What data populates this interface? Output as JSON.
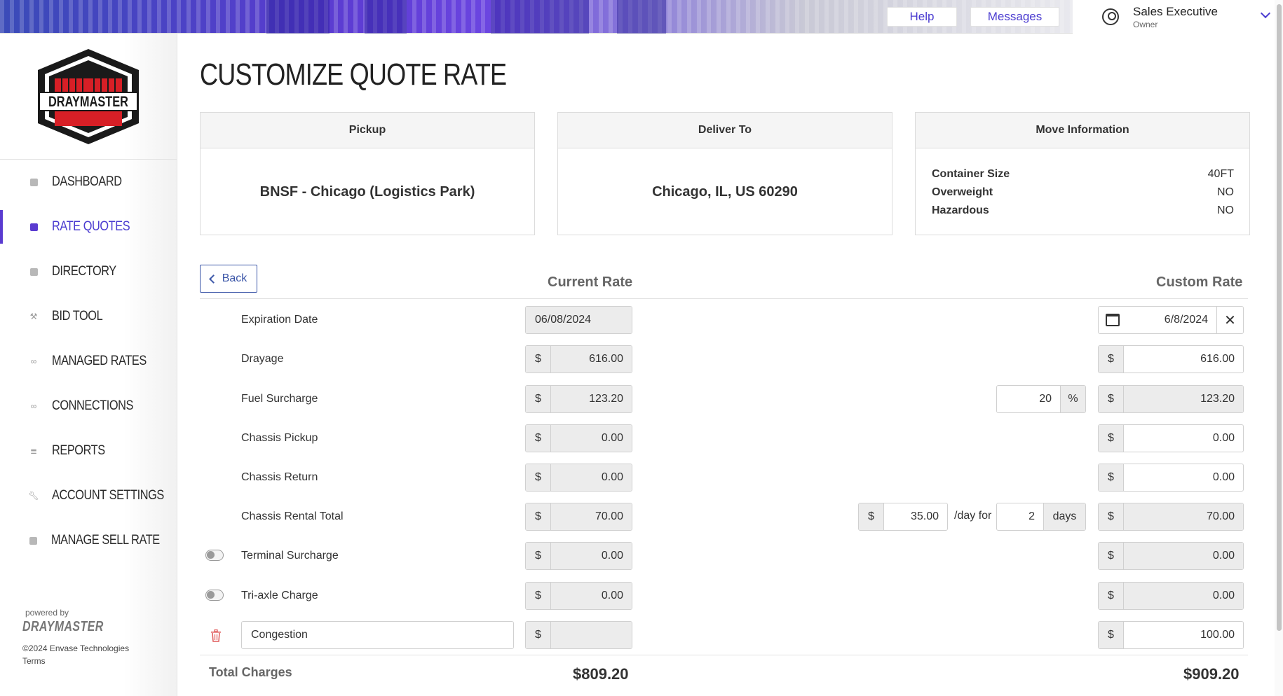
{
  "header": {
    "help_label": "Help",
    "messages_label": "Messages",
    "user_name": "Sales Executive",
    "user_role": "Owner"
  },
  "sidebar": {
    "logo_text": "DRAYMASTER",
    "items": [
      {
        "label": "DASHBOARD"
      },
      {
        "label": "RATE QUOTES"
      },
      {
        "label": "DIRECTORY"
      },
      {
        "label": "BID TOOL"
      },
      {
        "label": "MANAGED RATES"
      },
      {
        "label": "CONNECTIONS"
      },
      {
        "label": "REPORTS"
      },
      {
        "label": "ACCOUNT SETTINGS"
      },
      {
        "label": "MANAGE SELL RATE"
      }
    ],
    "powered_by": "powered by",
    "powered_brand": "DRAYMASTER",
    "copyright": "©2024 Envase Technologies",
    "terms": "Terms"
  },
  "page": {
    "title": "CUSTOMIZE QUOTE RATE",
    "pickup": {
      "head": "Pickup",
      "value": "BNSF - Chicago (Logistics Park)"
    },
    "deliver": {
      "head": "Deliver To",
      "value": "Chicago, IL, US 60290"
    },
    "move": {
      "head": "Move Information",
      "container_size_label": "Container Size",
      "container_size": "40FT",
      "overweight_label": "Overweight",
      "overweight": "NO",
      "hazardous_label": "Hazardous",
      "hazardous": "NO"
    },
    "back_label": "Back",
    "current_rate_head": "Current Rate",
    "custom_rate_head": "Custom Rate",
    "currency": "$",
    "rows": {
      "expiration": {
        "label": "Expiration Date",
        "current": "06/08/2024",
        "custom": "6/8/2024"
      },
      "drayage": {
        "label": "Drayage",
        "current": "616.00",
        "custom": "616.00"
      },
      "fuel": {
        "label": "Fuel Surcharge",
        "current": "123.20",
        "percent": "20",
        "percent_sign": "%",
        "custom": "123.20"
      },
      "chassis_pickup": {
        "label": "Chassis Pickup",
        "current": "0.00",
        "custom": "0.00"
      },
      "chassis_return": {
        "label": "Chassis Return",
        "current": "0.00",
        "custom": "0.00"
      },
      "chassis_rental": {
        "label": "Chassis Rental Total",
        "current": "70.00",
        "per_day": "35.00",
        "per_day_text": "/day for",
        "days": "2",
        "days_text": "days",
        "custom": "70.00"
      },
      "terminal": {
        "label": "Terminal Surcharge",
        "current": "0.00",
        "custom": "0.00"
      },
      "triaxle": {
        "label": "Tri-axle Charge",
        "current": "0.00",
        "custom": "0.00"
      },
      "congestion": {
        "label": "Congestion",
        "current": "",
        "custom": "100.00"
      }
    },
    "total_label": "Total Charges",
    "total_current": "$809.20",
    "total_custom": "$909.20"
  }
}
